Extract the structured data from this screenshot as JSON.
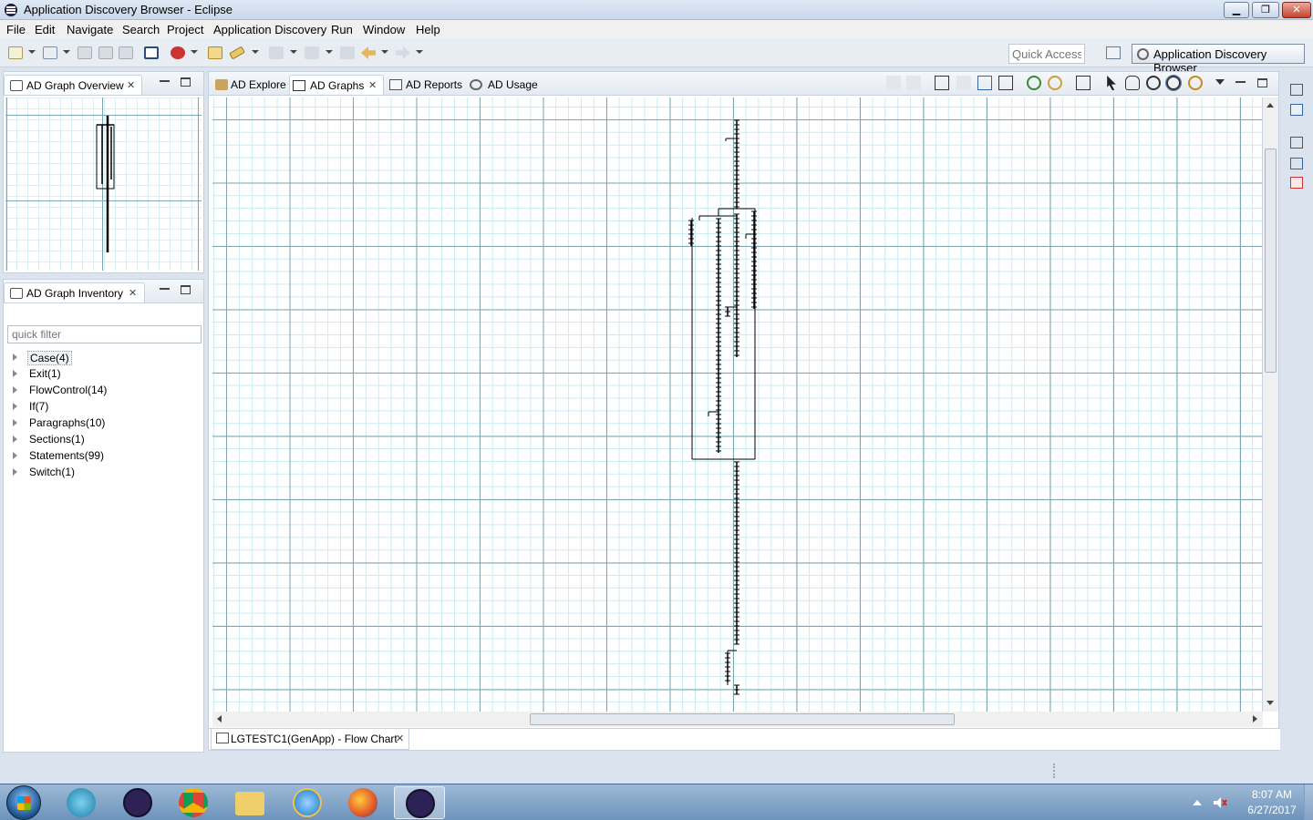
{
  "window": {
    "title": "Application Discovery Browser - Eclipse"
  },
  "menubar": [
    "File",
    "Edit",
    "Navigate",
    "Search",
    "Project",
    "Application Discovery",
    "Run",
    "Window",
    "Help"
  ],
  "toolbar": {
    "quick_access_placeholder": "Quick Access",
    "perspective_label": "Application Discovery Browser"
  },
  "overview_panel": {
    "tab_label": "AD Graph Overview"
  },
  "inventory_panel": {
    "tab_label": "AD Graph Inventory",
    "filter_placeholder": "quick filter",
    "items": [
      {
        "label": "Case(4)",
        "selected": true
      },
      {
        "label": "Exit(1)"
      },
      {
        "label": "FlowControl(14)"
      },
      {
        "label": "If(7)"
      },
      {
        "label": "Paragraphs(10)"
      },
      {
        "label": "Sections(1)"
      },
      {
        "label": "Statements(99)"
      },
      {
        "label": "Switch(1)"
      }
    ]
  },
  "editor": {
    "tabs": [
      {
        "label": "AD Explore"
      },
      {
        "label": "AD Graphs",
        "active": true
      },
      {
        "label": "AD Reports"
      },
      {
        "label": "AD Usage"
      }
    ],
    "document_tab": "LGTESTC1(GenApp) - Flow Chart"
  },
  "taskbar": {
    "apps": [
      "winzip",
      "eclipse",
      "chrome",
      "explorer",
      "internet-explorer",
      "firefox",
      "eclipse-active"
    ],
    "clock_time": "8:07 AM",
    "clock_date": "6/27/2017"
  },
  "colors": {
    "grid_major": "#7fa6b0",
    "grid_minor": "#c9ecf3",
    "accent": "#3c6ea5"
  }
}
